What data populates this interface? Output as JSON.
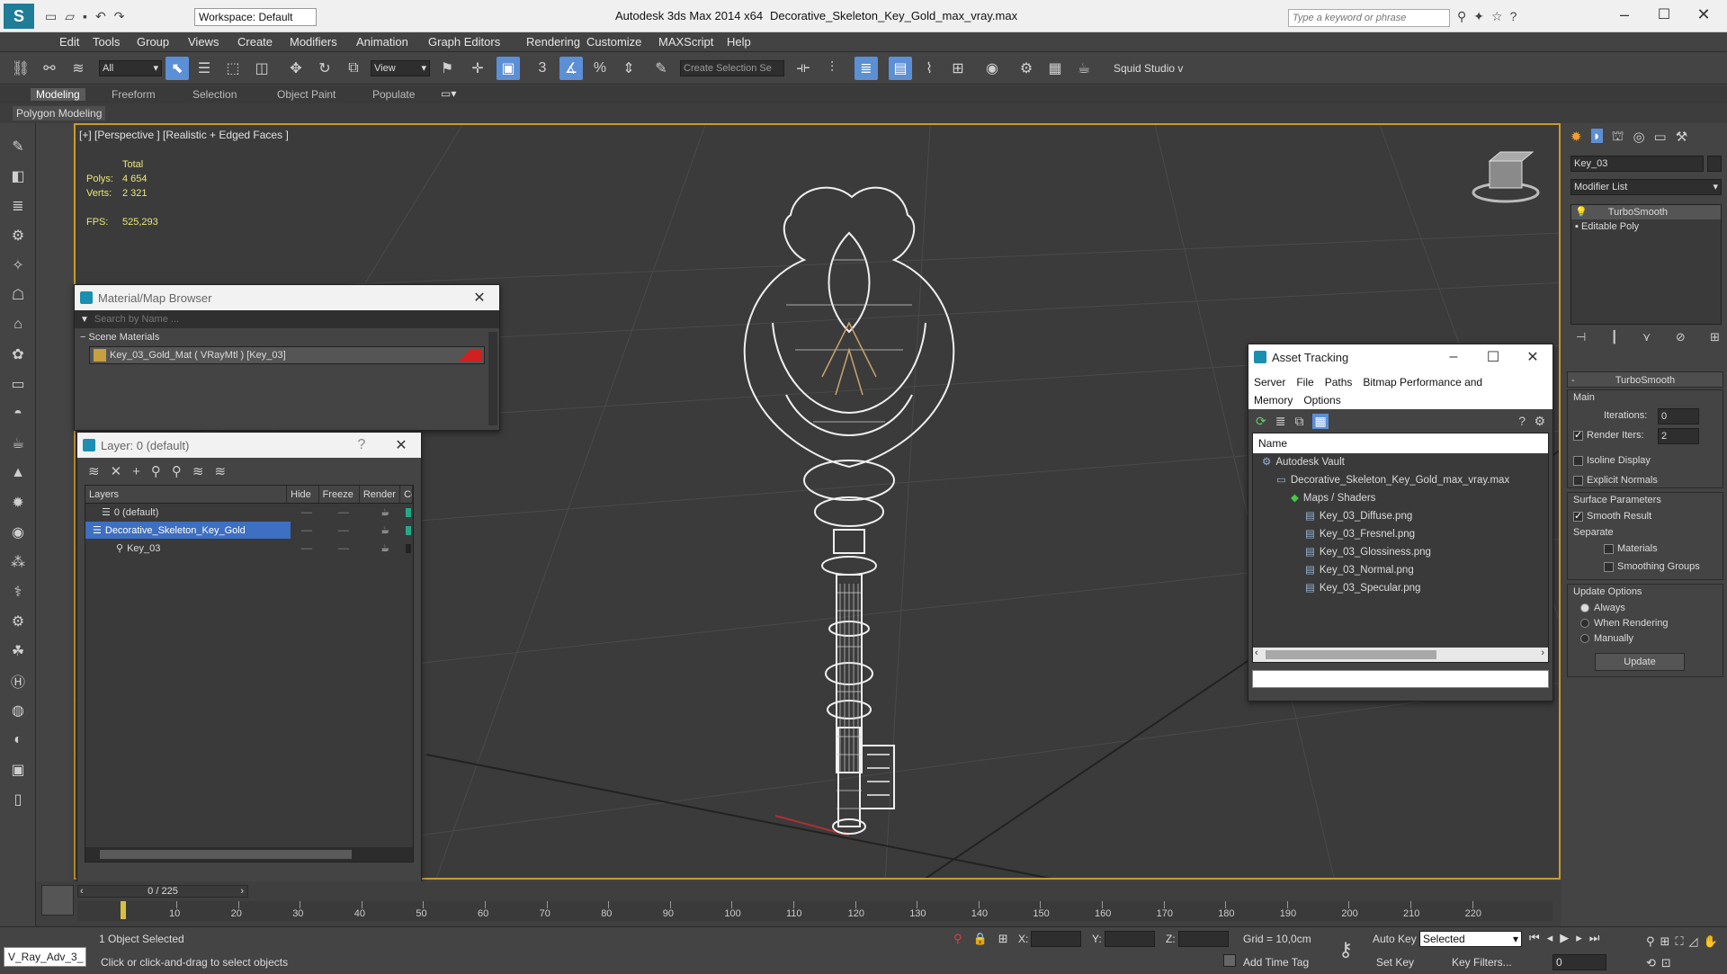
{
  "titlebar": {
    "workspace": "Workspace: Default",
    "app_version": "Autodesk 3ds Max  2014 x64",
    "filename": "Decorative_Skeleton_Key_Gold_max_vray.max",
    "search_placeholder": "Type a keyword or phrase"
  },
  "menu": [
    "Edit",
    "Tools",
    "Group",
    "Views",
    "Create",
    "Modifiers",
    "Animation",
    "Graph Editors",
    "Rendering",
    "Customize",
    "MAXScript",
    "Help"
  ],
  "toolbar": {
    "filter": "All",
    "refcoord": "View",
    "selection_set": "Create Selection Se",
    "squid": "Squid Studio v"
  },
  "ribbon_tabs": [
    "Modeling",
    "Freeform",
    "Selection",
    "Object Paint",
    "Populate"
  ],
  "ribbon_sub": "Polygon Modeling",
  "viewport": {
    "label": "[+] [Perspective ] [Realistic + Edged Faces ]",
    "stats_total": "Total",
    "polys_label": "Polys:",
    "polys": "4 654",
    "verts_label": "Verts:",
    "verts": "2 321",
    "fps_label": "FPS:",
    "fps": "525,293"
  },
  "material_browser": {
    "title": "Material/Map Browser",
    "search_placeholder": "Search by Name ...",
    "section": "Scene Materials",
    "material": "Key_03_Gold_Mat  ( VRayMtl )  [Key_03]"
  },
  "layer_panel": {
    "title": "Layer: 0 (default)",
    "help": "?",
    "columns": [
      "Layers",
      "Hide",
      "Freeze",
      "Render",
      "Co"
    ],
    "rows": [
      {
        "name": "0 (default)"
      },
      {
        "name": "Decorative_Skeleton_Key_Gold"
      },
      {
        "name": "Key_03"
      }
    ]
  },
  "asset_tracking": {
    "title": "Asset Tracking",
    "menu": [
      "Server",
      "File",
      "Paths",
      "Bitmap Performance and Memory",
      "Options"
    ],
    "column": "Name",
    "tree": [
      {
        "name": "Autodesk Vault",
        "indent": 0
      },
      {
        "name": "Decorative_Skeleton_Key_Gold_max_vray.max",
        "indent": 1
      },
      {
        "name": "Maps / Shaders",
        "indent": 2
      },
      {
        "name": "Key_03_Diffuse.png",
        "indent": 3
      },
      {
        "name": "Key_03_Fresnel.png",
        "indent": 3
      },
      {
        "name": "Key_03_Glossiness.png",
        "indent": 3
      },
      {
        "name": "Key_03_Normal.png",
        "indent": 3
      },
      {
        "name": "Key_03_Specular.png",
        "indent": 3
      }
    ]
  },
  "command_panel": {
    "object_name": "Key_03",
    "modifier_list": "Modifier List",
    "stack": [
      "TurboSmooth",
      "Editable Poly"
    ],
    "rollout": "TurboSmooth",
    "main": "Main",
    "iterations_label": "Iterations:",
    "iterations": "0",
    "render_iters_label": "Render Iters:",
    "render_iters": "2",
    "isoline": "Isoline Display",
    "explicit_normals": "Explicit Normals",
    "surface_params": "Surface Parameters",
    "smooth_result": "Smooth Result",
    "separate": "Separate",
    "materials": "Materials",
    "smoothing_groups": "Smoothing Groups",
    "update_options": "Update Options",
    "always": "Always",
    "when_rendering": "When Rendering",
    "manually": "Manually",
    "update_btn": "Update"
  },
  "timeline": {
    "frame": "0 / 225",
    "ticks": [
      "10",
      "20",
      "30",
      "40",
      "50",
      "60",
      "70",
      "80",
      "90",
      "100",
      "110",
      "120",
      "130",
      "140",
      "150",
      "160",
      "170",
      "180",
      "190",
      "200",
      "210",
      "220"
    ]
  },
  "status": {
    "script_label": "V_Ray_Adv_3_",
    "selected": "1 Object Selected",
    "prompt": "Click or click-and-drag to select objects",
    "x_label": "X:",
    "y_label": "Y:",
    "z_label": "Z:",
    "grid": "Grid = 10,0cm",
    "add_time_tag": "Add Time Tag",
    "auto_key": "Auto Key",
    "set_key": "Set Key",
    "selected_dd": "Selected",
    "key_filters": "Key Filters...",
    "frame_field": "0"
  },
  "colors": {
    "accent": "#5b8fd6",
    "viewport_border": "#c89b2a",
    "key_wire": "#f0f0f0"
  }
}
